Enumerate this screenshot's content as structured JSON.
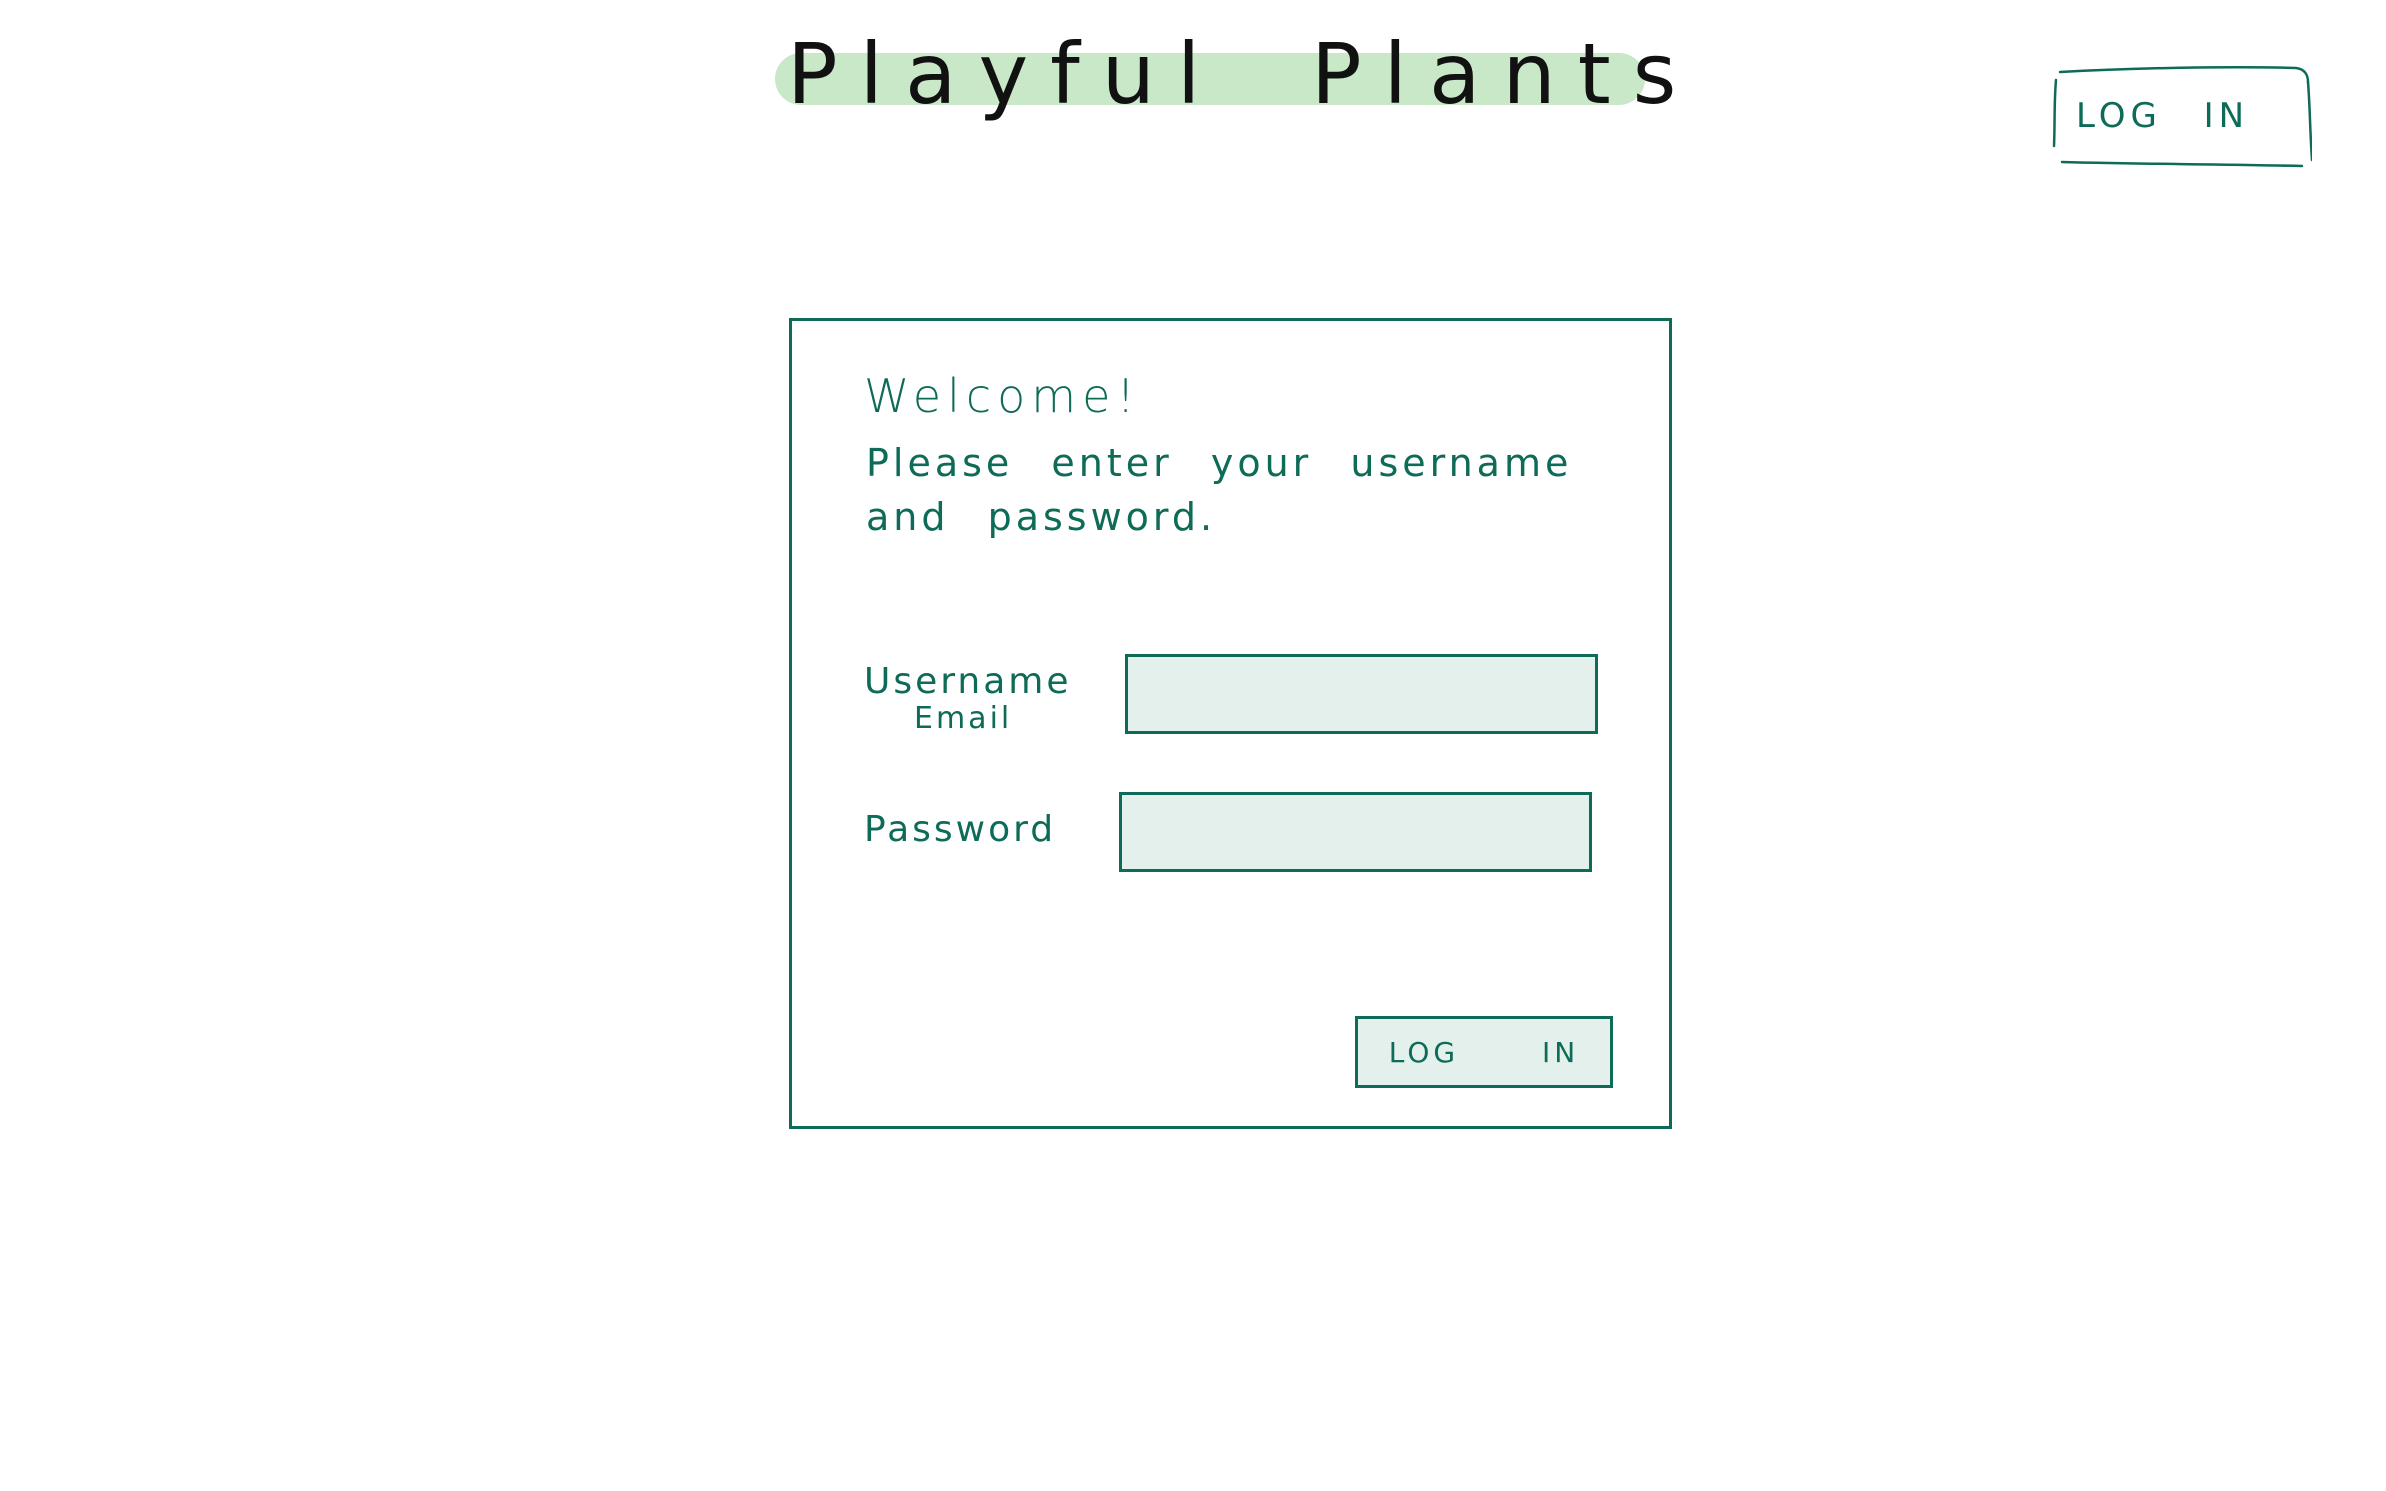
{
  "header": {
    "brand_title": "Playful Plants",
    "login_label": "LOG IN"
  },
  "login_card": {
    "welcome": "Welcome!",
    "instructions": "Please enter your username and password.",
    "username_label": "Username",
    "username_sublabel": "Email",
    "username_value": "",
    "password_label": "Password",
    "password_value": "",
    "submit_label": "LOG IN"
  },
  "colors": {
    "accent": "#0d6b57",
    "brand_highlight": "#c9e8c8",
    "input_fill": "#e3f0ec",
    "title_ink": "#111111",
    "background": "#ffffff"
  }
}
